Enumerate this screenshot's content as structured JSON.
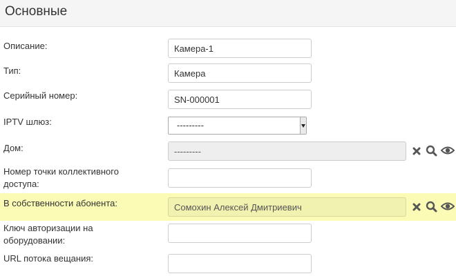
{
  "section": {
    "title": "Основные"
  },
  "fields": {
    "description": {
      "label": "Описание:",
      "value": "Камера-1"
    },
    "type": {
      "label": "Тип:",
      "value": "Камера"
    },
    "serial": {
      "label": "Серийный номер:",
      "value": "SN-000001"
    },
    "iptv": {
      "label": "IPTV шлюз:",
      "selected": "---------"
    },
    "house": {
      "label": "Дом:",
      "value": "---------"
    },
    "access_point": {
      "label": "Номер точки коллективного доступа:",
      "value": ""
    },
    "owner": {
      "label": "В собственности абонента:",
      "value": "Сомохин Алексей Дмитриевич"
    },
    "auth_key": {
      "label": "Ключ авторизации на оборудовании:",
      "value": ""
    },
    "stream_url": {
      "label": "URL потока вещания:",
      "value": ""
    }
  },
  "icons": {
    "clear": "times-icon",
    "search": "search-icon",
    "view": "eye-icon"
  },
  "colors": {
    "highlight": "#fbfbb6",
    "icon": "#555555"
  }
}
